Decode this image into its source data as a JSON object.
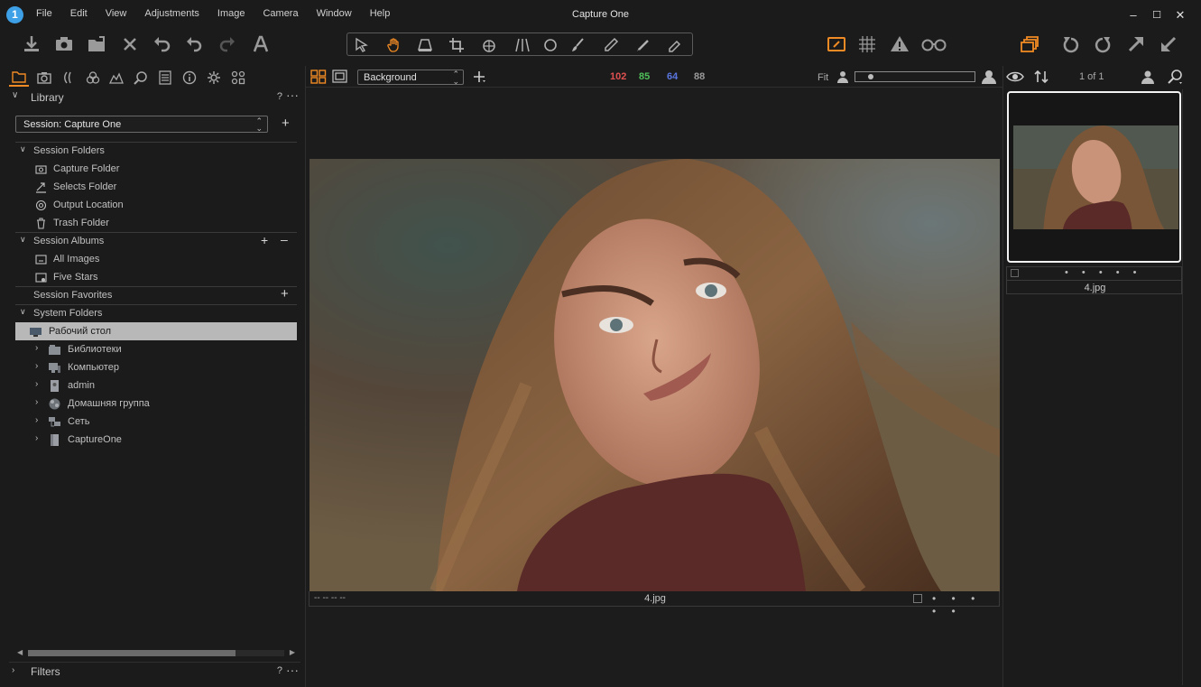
{
  "app": {
    "title": "Capture One",
    "logo": "1"
  },
  "menu": [
    "File",
    "Edit",
    "View",
    "Adjustments",
    "Image",
    "Camera",
    "Window",
    "Help"
  ],
  "window_controls": [
    "–",
    "☐",
    "✕"
  ],
  "colors": {
    "accent": "#f08a24",
    "red": "#e05050",
    "green": "#4fc05a",
    "blue": "#5a76e0",
    "gray": "#9a9a9a"
  },
  "library": {
    "title": "Library",
    "help": "?",
    "more": "···",
    "session_select": "Session: Capture One",
    "session_folders": {
      "label": "Session Folders",
      "items": [
        "Capture Folder",
        "Selects Folder",
        "Output Location",
        "Trash Folder"
      ]
    },
    "session_albums": {
      "label": "Session Albums",
      "items": [
        "All Images",
        "Five Stars"
      ]
    },
    "session_favorites": {
      "label": "Session Favorites"
    },
    "system_folders": {
      "label": "System Folders",
      "selected": "Рабочий стол",
      "items": [
        "Библиотеки",
        "Компьютер",
        "admin",
        "Домашняя группа",
        "Сеть",
        "CaptureOne"
      ]
    }
  },
  "filters": {
    "title": "Filters",
    "help": "?",
    "more": "···"
  },
  "viewer": {
    "style_select": "Background",
    "rgb": {
      "r": "102",
      "g": "85",
      "b": "64",
      "l": "88"
    },
    "fit_label": "Fit",
    "zoom_fraction": 0.1,
    "caption_left": "-- -- -- --",
    "filename": "4.jpg",
    "rating_dots": "• • • • •"
  },
  "browser": {
    "count": "1 of 1",
    "filename": "4.jpg",
    "rating_dots": "• • • • •"
  }
}
